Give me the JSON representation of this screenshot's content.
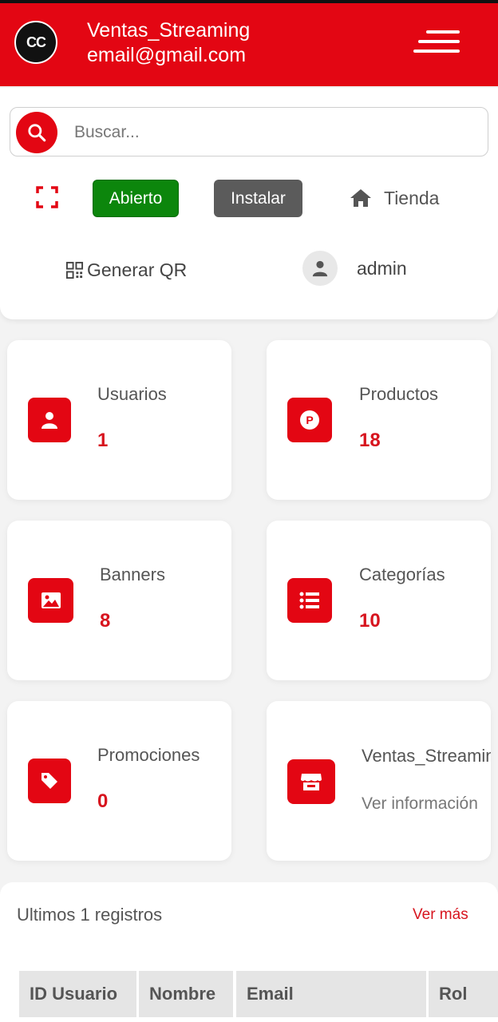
{
  "header": {
    "brand_name": "Ventas_Streaming",
    "email": "email@gmail.com",
    "logo_text": "CC"
  },
  "search": {
    "placeholder": "Buscar..."
  },
  "actions": {
    "status_label": "Abierto",
    "install_label": "Instalar",
    "shop_label": "Tienda",
    "qr_label": "Generar QR",
    "user_label": "admin"
  },
  "stats": [
    {
      "title": "Usuarios",
      "value": "1",
      "icon": "user-icon"
    },
    {
      "title": "Productos",
      "value": "18",
      "icon": "product-p-icon"
    },
    {
      "title": "Banners",
      "value": "8",
      "icon": "image-icon"
    },
    {
      "title": "Categorías",
      "value": "10",
      "icon": "list-icon"
    },
    {
      "title": "Promociones",
      "value": "0",
      "icon": "tag-icon"
    },
    {
      "title": "Ventas_Streaming",
      "link": "Ver información",
      "icon": "store-icon"
    }
  ],
  "records": {
    "title": "Ultimos 1 registros",
    "more_label": "Ver más",
    "columns": [
      "ID Usuario",
      "Nombre",
      "Email",
      "Rol"
    ]
  },
  "colors": {
    "accent": "#e30613",
    "open_green": "#0c860c",
    "install_gray": "#5b5b5b"
  }
}
